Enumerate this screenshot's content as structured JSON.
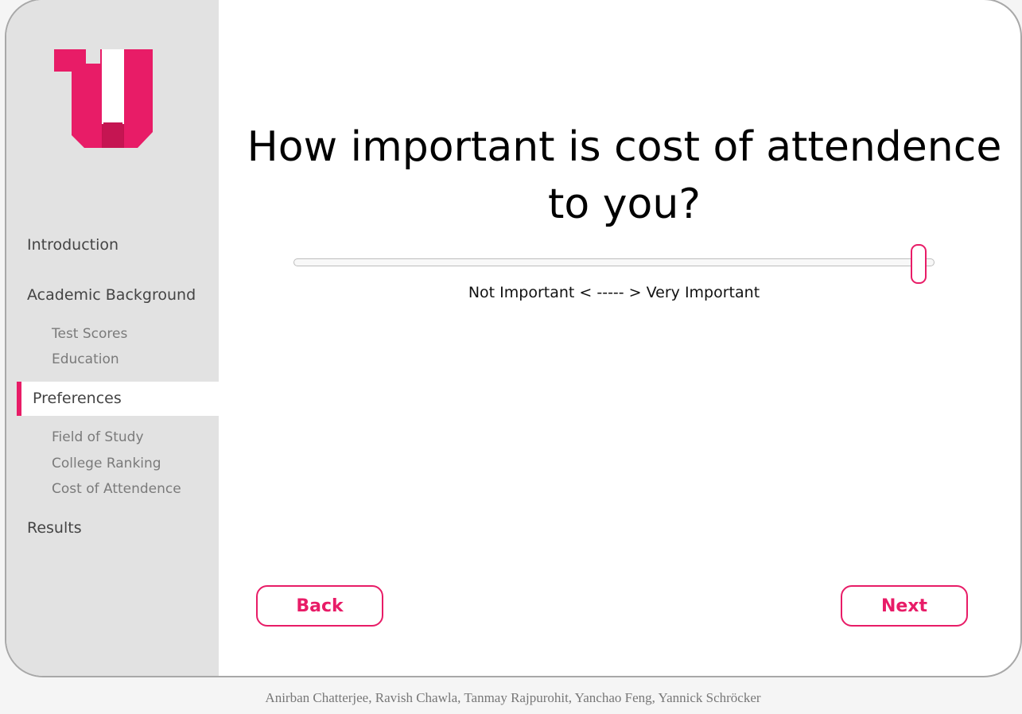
{
  "brand": {
    "accent_color": "#e81c67",
    "logo_icon": "u-logo"
  },
  "sidebar": {
    "items": [
      {
        "label": "Introduction"
      },
      {
        "label": "Academic Background",
        "children": [
          "Test Scores",
          "Education"
        ]
      },
      {
        "label": "Preferences",
        "active": true,
        "children": [
          "Field of Study",
          "College Ranking",
          "Cost of Attendence"
        ]
      },
      {
        "label": "Results"
      }
    ]
  },
  "main": {
    "question": "How important is cost of attendence to you?",
    "slider": {
      "value_fraction": 0.98,
      "scale_label": "Not Important < ----- > Very Important"
    },
    "back_label": "Back",
    "next_label": "Next"
  },
  "footer": {
    "authors": "Anirban Chatterjee, Ravish Chawla, Tanmay Rajpurohit, Yanchao Feng, Yannick Schröcker"
  }
}
